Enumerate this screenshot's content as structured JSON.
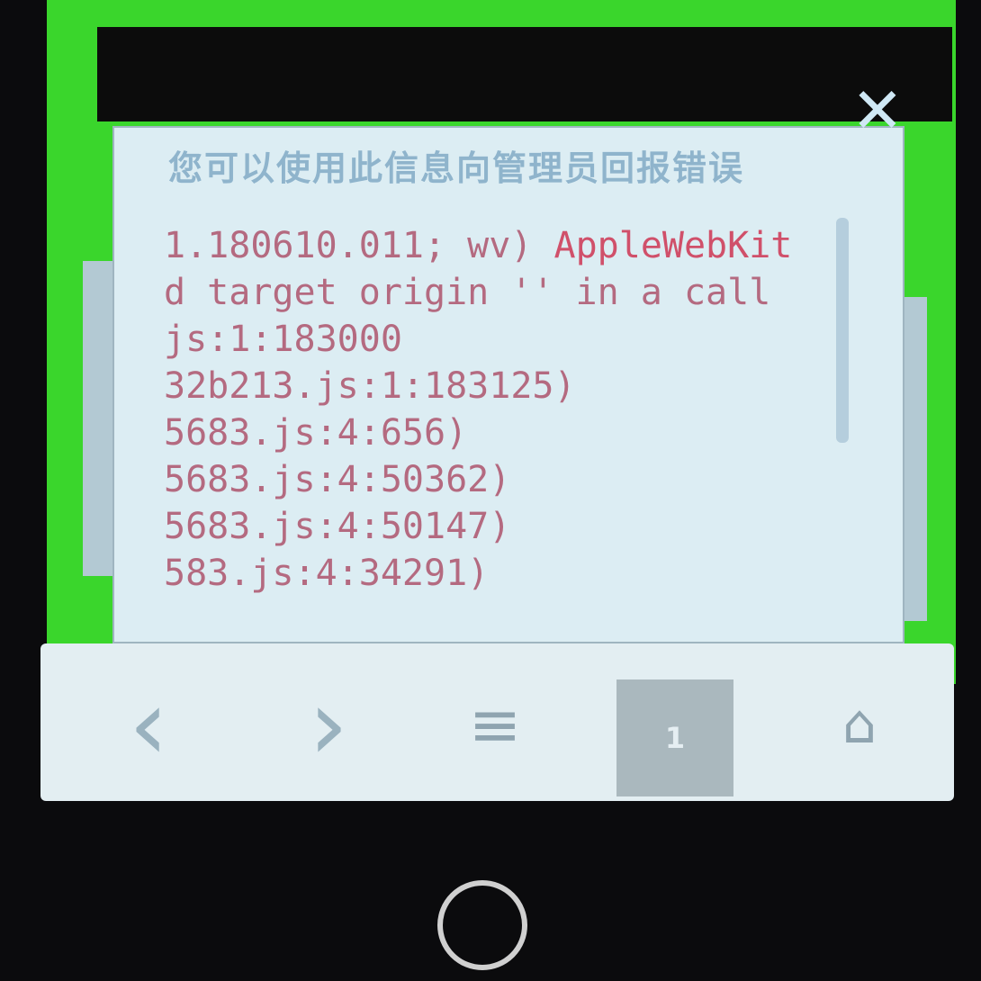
{
  "dialog": {
    "title": "您可以使用此信息向管理员回报错误",
    "close_icon": "close-icon",
    "log_lines": [
      "1.180610.011; wv) ",
      "AppleWebKit",
      "d target origin '' in a call",
      "js:1:183000",
      "32b213.js:1:183125)",
      "5683.js:4:656)",
      "5683.js:4:50362)",
      "5683.js:4:50147)",
      "583.js:4:34291)"
    ]
  },
  "navbar": {
    "back_icon": "‹",
    "forward_icon": "›",
    "menu_icon": "≡",
    "page_number": "1",
    "home_icon": "⌂"
  },
  "colors": {
    "frame": "#3ad62c",
    "dialog": "#dcedf3",
    "log_text": "#b46a80"
  }
}
